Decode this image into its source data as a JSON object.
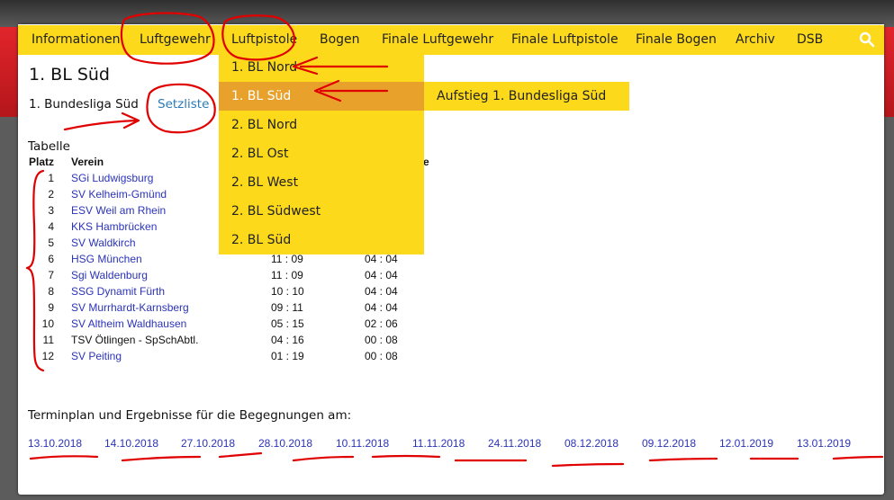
{
  "nav": {
    "items": [
      "Informationen",
      "Luftgewehr",
      "Luftpistole",
      "Bogen",
      "Finale Luftgewehr",
      "Finale Luftpistole",
      "Finale Bogen",
      "Archiv",
      "DSB"
    ],
    "search_icon": "search-icon"
  },
  "dropdown": {
    "items": [
      "1. BL Nord",
      "1. BL Süd",
      "2. BL Nord",
      "2. BL Ost",
      "2. BL West",
      "2. BL Südwest",
      "2. BL Süd"
    ],
    "active": "1. BL Süd",
    "submenu_item": "Aufstieg 1. Bundesliga Süd"
  },
  "page": {
    "title": "1. BL Süd",
    "subtitle": "1. Bundesliga Süd",
    "tab_link": "Setzliste"
  },
  "table": {
    "title": "Tabelle",
    "headers": [
      "Platz",
      "Verein",
      "te"
    ],
    "rows": [
      {
        "rank": "1",
        "team": "SGi Ludwigsburg",
        "m1": "",
        "m2": "",
        "link": true
      },
      {
        "rank": "2",
        "team": "SV Kelheim-Gmünd",
        "m1": "",
        "m2": "",
        "link": true
      },
      {
        "rank": "3",
        "team": "ESV Weil am Rhein",
        "m1": "",
        "m2": "",
        "link": true
      },
      {
        "rank": "4",
        "team": "KKS Hambrücken",
        "m1": "",
        "m2": "",
        "link": true
      },
      {
        "rank": "5",
        "team": "SV Waldkirch",
        "m1": "",
        "m2": "",
        "link": true
      },
      {
        "rank": "6",
        "team": "HSG München",
        "m1": "11 : 09",
        "m2": "04 : 04",
        "link": true
      },
      {
        "rank": "7",
        "team": "Sgi Waldenburg",
        "m1": "11 : 09",
        "m2": "04 : 04",
        "link": true
      },
      {
        "rank": "8",
        "team": "SSG Dynamit Fürth",
        "m1": "10 : 10",
        "m2": "04 : 04",
        "link": true
      },
      {
        "rank": "9",
        "team": "SV Murrhardt-Karnsberg",
        "m1": "09 : 11",
        "m2": "04 : 04",
        "link": true
      },
      {
        "rank": "10",
        "team": "SV Altheim Waldhausen",
        "m1": "05 : 15",
        "m2": "02 : 06",
        "link": true
      },
      {
        "rank": "11",
        "team": "TSV Ötlingen - SpSchAbtl.",
        "m1": "04 : 16",
        "m2": "00 : 08",
        "link": false
      },
      {
        "rank": "12",
        "team": "SV Peiting",
        "m1": "01 : 19",
        "m2": "00 : 08",
        "link": true
      }
    ]
  },
  "schedule": {
    "title": "Terminplan und Ergebnisse für die Begegnungen am:",
    "dates": [
      "13.10.2018",
      "14.10.2018",
      "27.10.2018",
      "28.10.2018",
      "10.11.2018",
      "11.11.2018",
      "24.11.2018",
      "08.12.2018",
      "09.12.2018",
      "12.01.2019",
      "13.01.2019"
    ]
  },
  "colors": {
    "nav_bg": "#fcd91a",
    "active_bg": "#e8a22c",
    "link": "#2b33b8",
    "tab_link": "#2a7ab8",
    "annotation": "#e00000"
  }
}
